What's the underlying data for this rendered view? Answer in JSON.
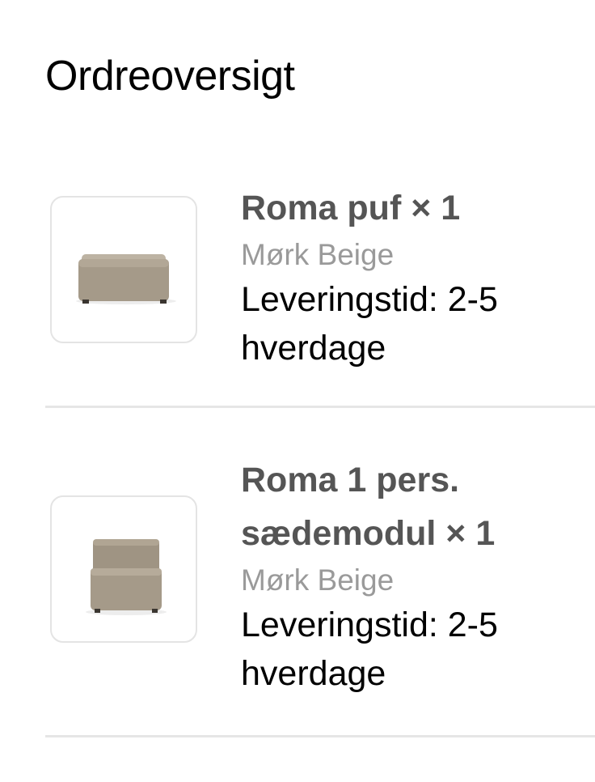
{
  "page": {
    "title": "Ordreoversigt"
  },
  "order_items": [
    {
      "name": "Roma puf × 1",
      "variant": "Mørk Beige",
      "delivery": "Leveringstid: 2-5 hverdage",
      "image_icon": "pouf-image"
    },
    {
      "name": "Roma 1 pers. sædemodul × 1",
      "variant": "Mørk Beige",
      "delivery": "Leveringstid: 2-5 hverdage",
      "image_icon": "seat-module-image"
    }
  ],
  "colors": {
    "name_text": "#555555",
    "variant_text": "#9a9a9a",
    "divider": "#e6e6e6",
    "fabric": "#a59a89"
  }
}
